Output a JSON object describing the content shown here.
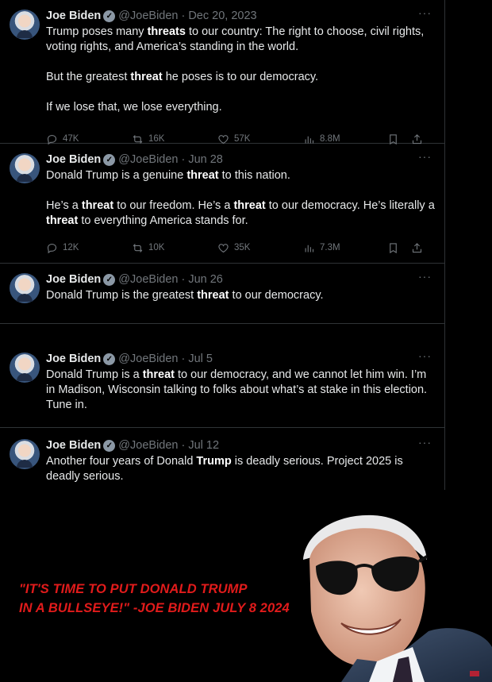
{
  "tweets": [
    {
      "name": "Joe Biden",
      "handle": "@JoeBiden",
      "date": "Dec 20, 2023",
      "paragraphs": [
        [
          "Trump poses many ",
          {
            "b": "threats"
          },
          " to our country: The right to choose, civil rights, voting rights, and America’s standing in the world."
        ],
        [
          "But the greatest ",
          {
            "b": "threat"
          },
          " he poses is to our democracy."
        ],
        [
          "If we lose that, we lose everything."
        ]
      ],
      "stats": {
        "replies": "47K",
        "reposts": "16K",
        "likes": "57K",
        "views": "8.8M"
      }
    },
    {
      "name": "Joe Biden",
      "handle": "@JoeBiden",
      "date": "Jun 28",
      "paragraphs": [
        [
          "Donald Trump is a genuine ",
          {
            "b": "threat"
          },
          " to this nation."
        ],
        [
          "He’s a ",
          {
            "b": "threat"
          },
          " to our freedom. He’s a ",
          {
            "b": "threat"
          },
          " to our democracy. He’s literally a ",
          {
            "b": "threat"
          },
          " to everything America stands for."
        ]
      ],
      "stats": {
        "replies": "12K",
        "reposts": "10K",
        "likes": "35K",
        "views": "7.3M"
      }
    },
    {
      "name": "Joe Biden",
      "handle": "@JoeBiden",
      "date": "Jun 26",
      "paragraphs": [
        [
          "Donald Trump is the greatest ",
          {
            "b": "threat"
          },
          " to our democracy."
        ]
      ]
    },
    {
      "name": "Joe Biden",
      "handle": "@JoeBiden",
      "date": "Jul 5",
      "paragraphs": [
        [
          "Donald Trump is a ",
          {
            "b": "threat"
          },
          " to our democracy, and we cannot let him win. I’m in Madison, Wisconsin talking to folks about what’s at stake in this election. Tune in."
        ]
      ]
    },
    {
      "name": "Joe Biden",
      "handle": "@JoeBiden",
      "date": "Jul 12",
      "paragraphs": [
        [
          "Another four years of Donald ",
          {
            "b": "Trump"
          },
          " is deadly serious. Project 2025 is deadly serious."
        ]
      ]
    }
  ],
  "separator": "·",
  "more_glyph": "···",
  "verified_glyph": "✓",
  "caption": {
    "line1": "\"IT'S TIME TO PUT DONALD TRUMP",
    "line2": "IN A BULLSEYE!\" -JOE BIDEN JULY 8 2024",
    "color": "#e11b1b"
  },
  "icons": {
    "reply": "reply-icon",
    "repost": "repost-icon",
    "like": "like-icon",
    "views": "views-icon",
    "bookmark": "bookmark-icon",
    "share": "share-icon"
  }
}
